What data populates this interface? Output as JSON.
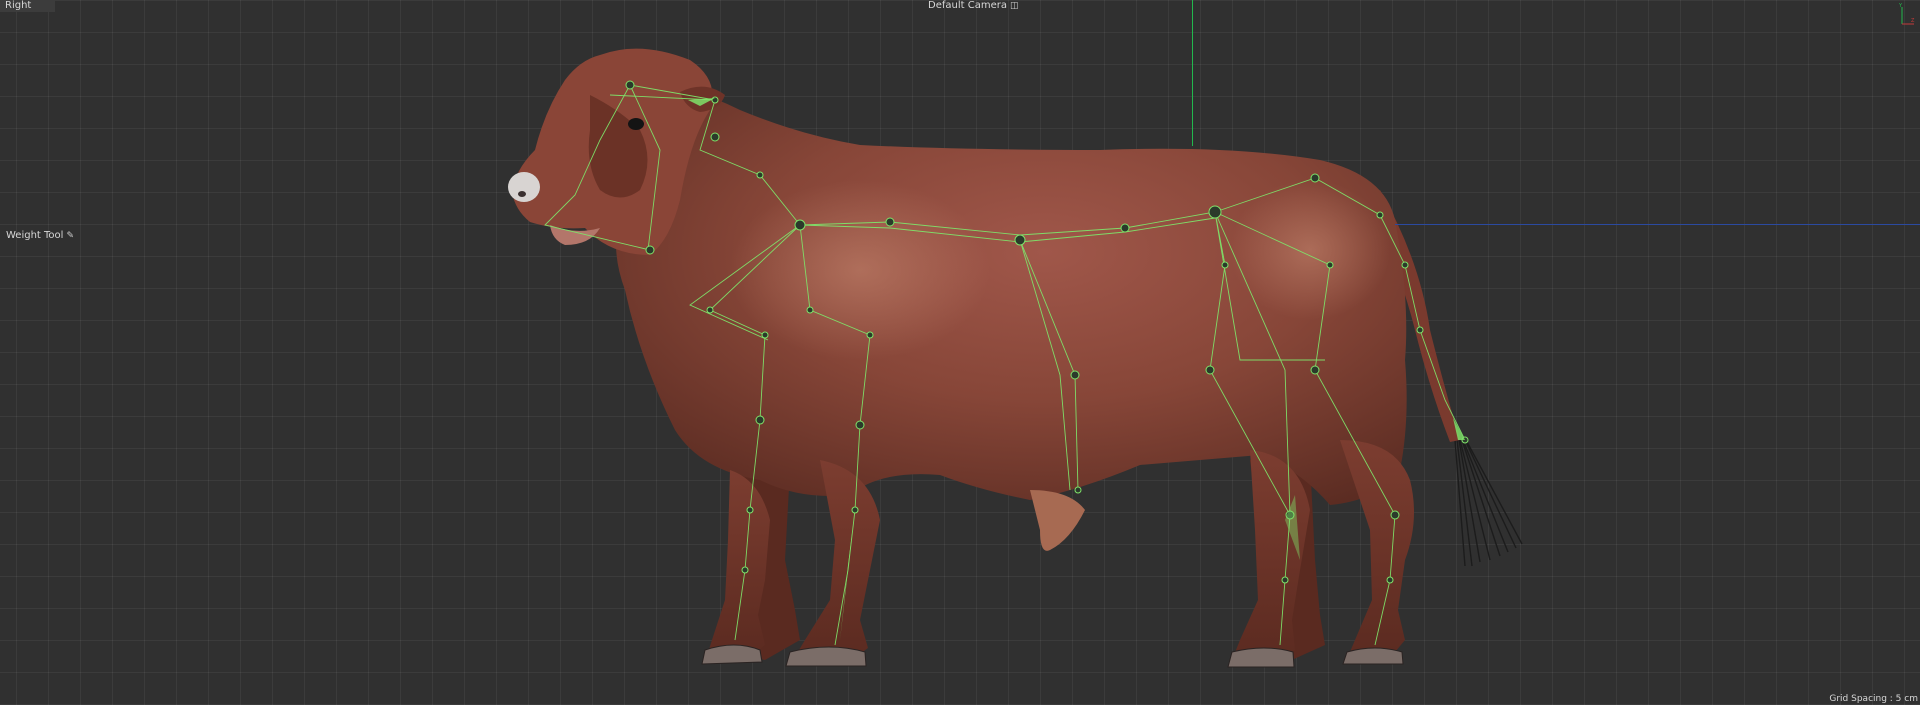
{
  "viewport": {
    "view_name": "Right",
    "camera_name": "Default Camera",
    "camera_icon": "camera-icon",
    "active_tool": "Weight Tool",
    "tool_icon": "brush-icon",
    "grid_spacing": "Grid Spacing : 5 cm"
  },
  "colors": {
    "background": "#303030",
    "grid": "#3a3a3a",
    "y_axis": "#22b84d",
    "z_axis": "#2b4aa0",
    "joint": "#7fe36a",
    "hide": "#8a4a3a"
  }
}
